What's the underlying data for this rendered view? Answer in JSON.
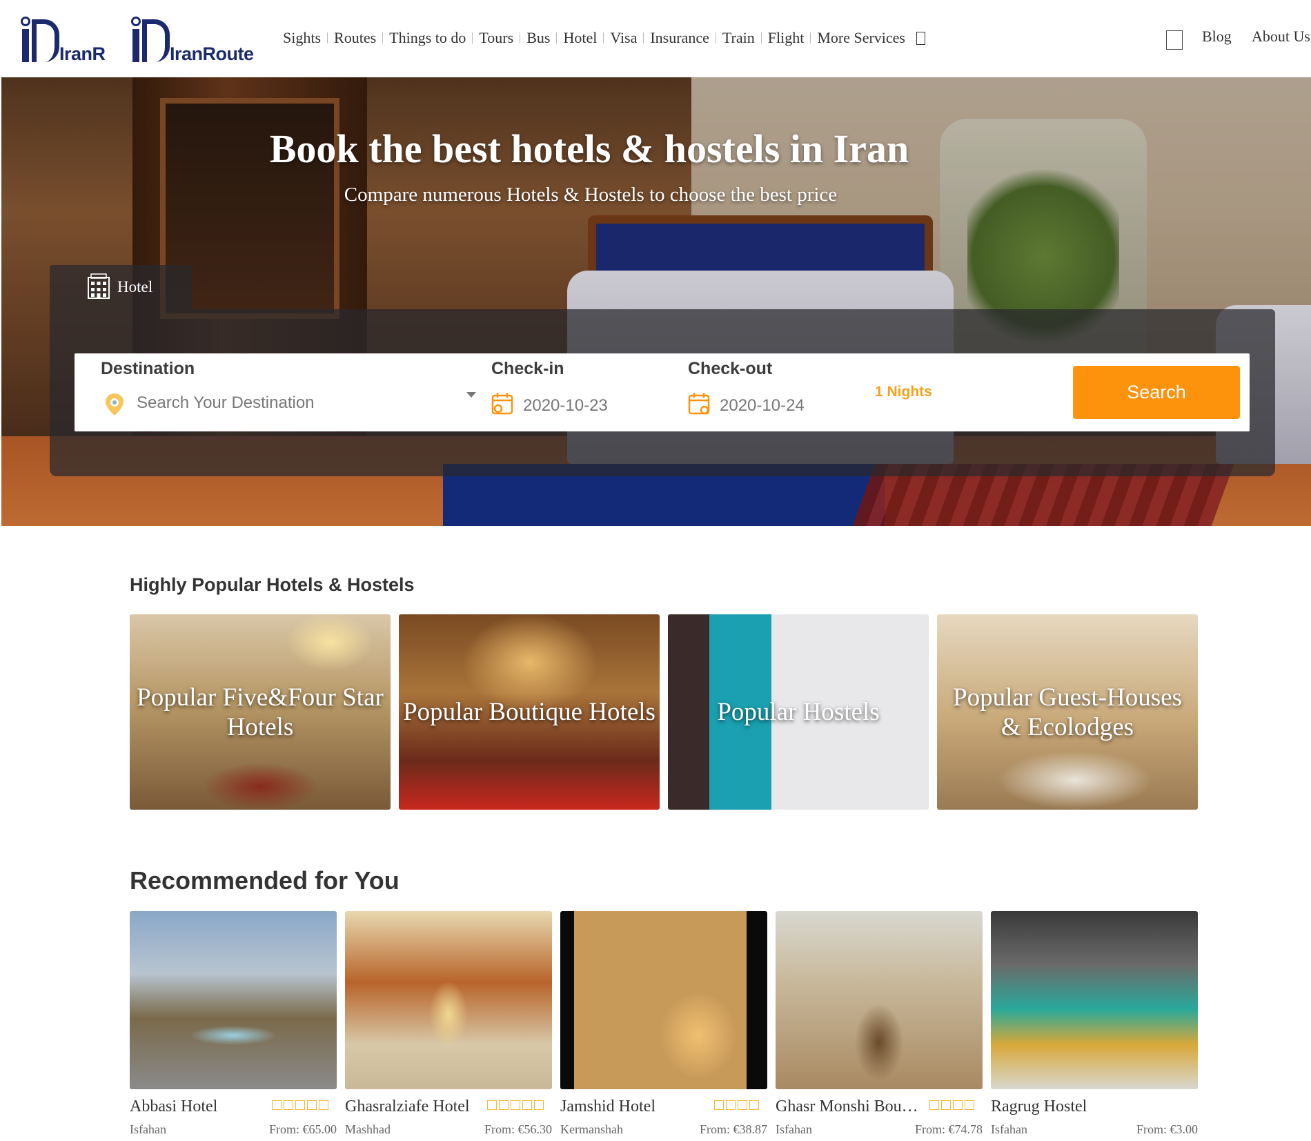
{
  "header": {
    "logo_small_text": "IranR",
    "logo_big_text": "IranRoute",
    "nav": [
      "Sights",
      "Routes",
      "Things to do",
      "Tours",
      "Bus",
      "Hotel",
      "Visa",
      "Insurance",
      "Train",
      "Flight",
      "More Services"
    ],
    "blog": "Blog",
    "about": "About Us"
  },
  "hero": {
    "title": "Book the best hotels & hostels in Iran",
    "subtitle": "Compare numerous Hotels & Hostels to choose the best price",
    "tab_label": "Hotel"
  },
  "search": {
    "destination_label": "Destination",
    "destination_placeholder": "Search Your Destination",
    "checkin_label": "Check-in",
    "checkin_value": "2020-10-23",
    "checkout_label": "Check-out",
    "checkout_value": "2020-10-24",
    "nights": "1 Nights",
    "button": "Search"
  },
  "popular": {
    "title": "Highly Popular Hotels & Hostels",
    "items": [
      {
        "label": "Popular Five&Four Star Hotels"
      },
      {
        "label": "Popular Boutique Hotels"
      },
      {
        "label": "Popular Hostels"
      },
      {
        "label": "Popular Guest-Houses & Ecolodges"
      }
    ]
  },
  "recommended": {
    "title": "Recommended for You",
    "items": [
      {
        "name": "Abbasi Hotel",
        "city": "Isfahan",
        "price": "From: €65.00",
        "stars": 5
      },
      {
        "name": "Ghasralziafe Hotel",
        "city": "Mashhad",
        "price": "From: €56.30",
        "stars": 5
      },
      {
        "name": "Jamshid Hotel",
        "city": "Kermanshah",
        "price": "From: €38.87",
        "stars": 4
      },
      {
        "name": "Ghasr Monshi Boutique Hotel",
        "city": "Isfahan",
        "price": "From: €74.78",
        "stars": 4
      },
      {
        "name": "Ragrug Hostel",
        "city": "Isfahan",
        "price": "From: €3.00",
        "stars": 0
      }
    ]
  },
  "colors": {
    "brand_navy": "#1a2a6c",
    "accent_orange": "#fd930d",
    "nights_orange": "#f6a01a",
    "star_gold": "#f5b82e"
  }
}
